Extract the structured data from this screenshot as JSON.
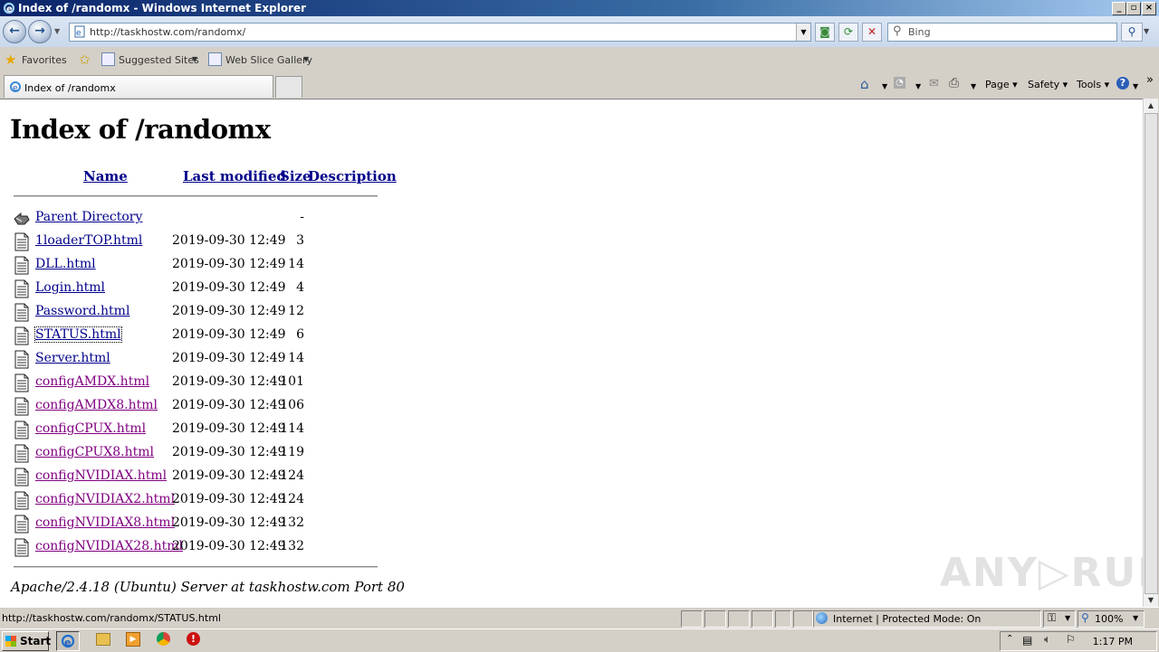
{
  "window": {
    "title": "Index of /randomx - Windows Internet Explorer",
    "controls": [
      "minimize",
      "restore",
      "close"
    ]
  },
  "navbar": {
    "address": "http://taskhostw.com/randomx/",
    "search_placeholder": "Bing"
  },
  "favorites_bar": {
    "favorites_label": "Favorites",
    "suggested_sites": "Suggested Sites",
    "web_slice_gallery": "Web Slice Gallery"
  },
  "tabs": [
    {
      "label": "Index of /randomx",
      "active": true
    }
  ],
  "command_bar": {
    "page": "Page",
    "safety": "Safety",
    "tools": "Tools",
    "more": "»"
  },
  "page": {
    "heading": "Index of /randomx",
    "columns": {
      "name": "Name",
      "last_modified": "Last modified",
      "size": "Size",
      "description": "Description"
    },
    "parent": {
      "name": "Parent Directory",
      "size": "-"
    },
    "files": [
      {
        "name": "1loaderTOP.html",
        "modified": "2019-09-30 12:49",
        "size": "3",
        "visited": false
      },
      {
        "name": "DLL.html",
        "modified": "2019-09-30 12:49",
        "size": "14",
        "visited": false
      },
      {
        "name": "Login.html",
        "modified": "2019-09-30 12:49",
        "size": "4",
        "visited": false
      },
      {
        "name": "Password.html",
        "modified": "2019-09-30 12:49",
        "size": "12",
        "visited": false
      },
      {
        "name": "STATUS.html",
        "modified": "2019-09-30 12:49",
        "size": "6",
        "visited": false,
        "focused": true
      },
      {
        "name": "Server.html",
        "modified": "2019-09-30 12:49",
        "size": "14",
        "visited": false
      },
      {
        "name": "configAMDX.html",
        "modified": "2019-09-30 12:49",
        "size": "101",
        "visited": true
      },
      {
        "name": "configAMDX8.html",
        "modified": "2019-09-30 12:49",
        "size": "106",
        "visited": true
      },
      {
        "name": "configCPUX.html",
        "modified": "2019-09-30 12:49",
        "size": "114",
        "visited": true
      },
      {
        "name": "configCPUX8.html",
        "modified": "2019-09-30 12:49",
        "size": "119",
        "visited": true
      },
      {
        "name": "configNVIDIAX.html",
        "modified": "2019-09-30 12:49",
        "size": "124",
        "visited": true
      },
      {
        "name": "configNVIDIAX2.html",
        "modified": "2019-09-30 12:49",
        "size": "124",
        "visited": true
      },
      {
        "name": "configNVIDIAX8.html",
        "modified": "2019-09-30 12:49",
        "size": "132",
        "visited": true
      },
      {
        "name": "configNVIDIAX28.html",
        "modified": "2019-09-30 12:49",
        "size": "132",
        "visited": true
      }
    ],
    "footer": "Apache/2.4.18 (Ubuntu) Server at taskhostw.com Port 80",
    "watermark": "ANY▷RUN"
  },
  "statusbar": {
    "url": "http://taskhostw.com/randomx/STATUS.html",
    "zone": "Internet | Protected Mode: On",
    "zoom": "100%"
  },
  "taskbar": {
    "start_label": "Start",
    "clock": "1:17 PM"
  },
  "colors": {
    "link": "#00008b",
    "visited_link": "#800080",
    "titlebar": "#0a246a"
  }
}
